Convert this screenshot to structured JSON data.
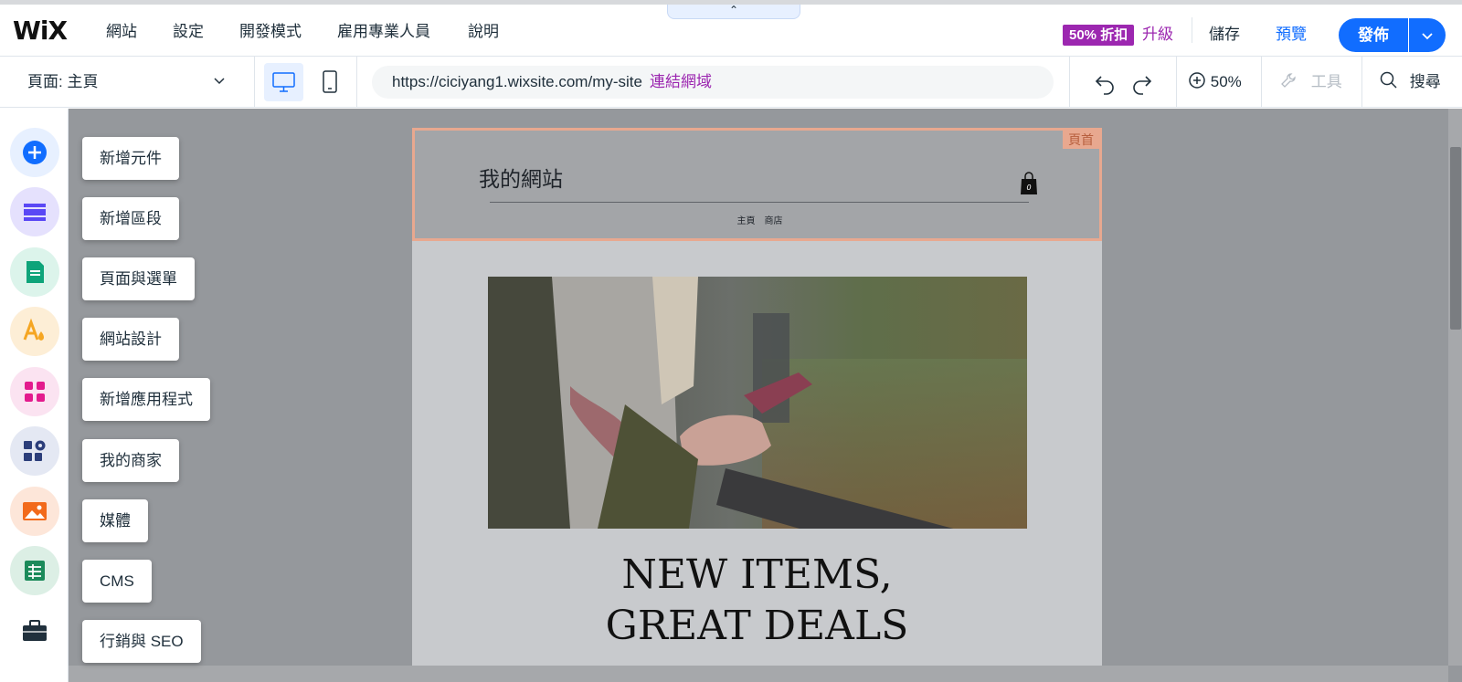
{
  "topbar": {
    "logo": "WiX",
    "menu": [
      "網站",
      "設定",
      "開發模式",
      "雇用專業人員",
      "說明"
    ],
    "promo_badge": "50% 折扣",
    "upgrade": "升級",
    "save": "儲存",
    "preview": "預覽",
    "publish": "發佈",
    "collapse_glyph": "⌃"
  },
  "toolbar": {
    "page_label": "頁面:  主頁",
    "url": "https://ciciyang1.wixsite.com/my-site",
    "connect_domain": "連結網域",
    "zoom": "50%",
    "tools": "工具",
    "search": "搜尋"
  },
  "left_panel": {
    "items": [
      {
        "label": "新增元件",
        "icon": "plus-icon",
        "color": "#116dff",
        "bg": "#e7f0ff"
      },
      {
        "label": "新增區段",
        "icon": "sections-icon",
        "color": "#5a48f5",
        "bg": "#e5e1fd"
      },
      {
        "label": "頁面與選單",
        "icon": "page-icon",
        "color": "#0ea47a",
        "bg": "#dcf4eb"
      },
      {
        "label": "網站設計",
        "icon": "design-icon",
        "color": "#f5a623",
        "bg": "#fdeed6"
      },
      {
        "label": "新增應用程式",
        "icon": "apps-icon",
        "color": "#e31b8d",
        "bg": "#fbe3f1"
      },
      {
        "label": "我的商家",
        "icon": "business-icon",
        "color": "#2c3e7a",
        "bg": "#e4e8f3"
      },
      {
        "label": "媒體",
        "icon": "media-icon",
        "color": "#f26a1b",
        "bg": "#fde6d9"
      },
      {
        "label": "CMS",
        "icon": "cms-icon",
        "color": "#1b8a5a",
        "bg": "#dcefe5"
      },
      {
        "label": "行銷與 SEO",
        "icon": "briefcase-icon",
        "color": "#20303c",
        "bg": "#ffffff"
      }
    ]
  },
  "site": {
    "header_tag": "頁首",
    "title": "我的網站",
    "nav": [
      "主頁",
      "商店"
    ],
    "heading": "NEW ITEMS, GREAT DEALS"
  },
  "colors": {
    "accent": "#116dff",
    "promo": "#9c27b0",
    "header_selection": "#e8a88f"
  }
}
